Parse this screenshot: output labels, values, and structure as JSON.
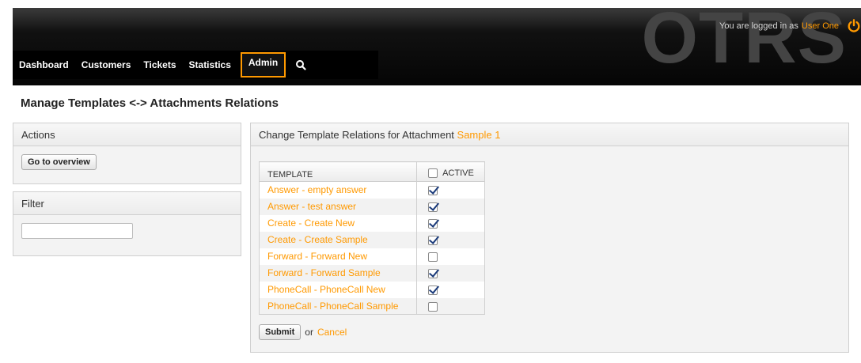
{
  "header": {
    "logo": "OTRS",
    "logged_in_prefix": "You are logged in as",
    "user_name": "User One"
  },
  "nav": {
    "items": [
      {
        "label": "Dashboard"
      },
      {
        "label": "Customers"
      },
      {
        "label": "Tickets"
      },
      {
        "label": "Statistics"
      },
      {
        "label": "Admin",
        "active": true
      }
    ]
  },
  "page": {
    "title": "Manage Templates <-> Attachments Relations"
  },
  "sidebar": {
    "actions_title": "Actions",
    "go_to_overview": "Go to overview",
    "filter_title": "Filter",
    "filter_value": ""
  },
  "main": {
    "title_prefix": "Change Template Relations for Attachment",
    "attachment_name": "Sample 1",
    "col_template": "TEMPLATE",
    "col_active": "ACTIVE",
    "rows": [
      {
        "template": "Answer - empty answer",
        "active": true
      },
      {
        "template": "Answer - test answer",
        "active": true
      },
      {
        "template": "Create - Create New",
        "active": true
      },
      {
        "template": "Create - Create Sample",
        "active": true
      },
      {
        "template": "Forward - Forward New",
        "active": false
      },
      {
        "template": "Forward - Forward Sample",
        "active": true
      },
      {
        "template": "PhoneCall - PhoneCall New",
        "active": true
      },
      {
        "template": "PhoneCall - PhoneCall Sample",
        "active": false
      }
    ],
    "submit_label": "Submit",
    "or_text": "or",
    "cancel_label": "Cancel"
  },
  "colors": {
    "accent": "#ff9900",
    "header_bg": "#111111"
  },
  "icons": {
    "logout": "power-icon",
    "search": "search-icon"
  }
}
